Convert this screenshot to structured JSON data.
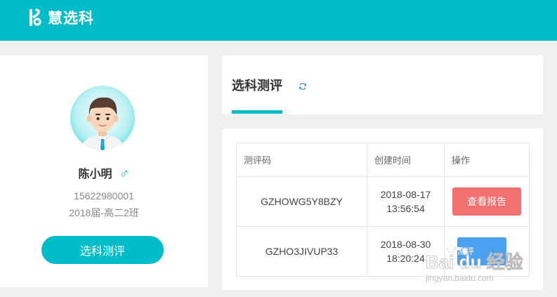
{
  "app": {
    "title": "慧选科"
  },
  "profile": {
    "name": "陈小明",
    "gender_symbol": "♂",
    "phone": "15622980001",
    "class": "2018届-高二2班",
    "button_label": "选科测评"
  },
  "tabs": {
    "active_label": "选科测评"
  },
  "table": {
    "headers": [
      "测评码",
      "创建时间",
      "操作"
    ],
    "rows": [
      {
        "code": "GZHOWG5Y8BZY",
        "date": "2018-08-17",
        "time": "13:56:54",
        "action": "查看报告",
        "action_color": "#f2706d"
      },
      {
        "code": "GZHO3JIVUP33",
        "date": "2018-08-30",
        "time": "18:20:24",
        "action": "测评",
        "action_color": "#4ba1f0"
      }
    ]
  },
  "watermark": {
    "brand": "Bai du 经验",
    "url": "jingyan.baidu.com"
  },
  "colors": {
    "brand": "#00bcc8",
    "report": "#f2706d",
    "test": "#4ba1f0"
  }
}
